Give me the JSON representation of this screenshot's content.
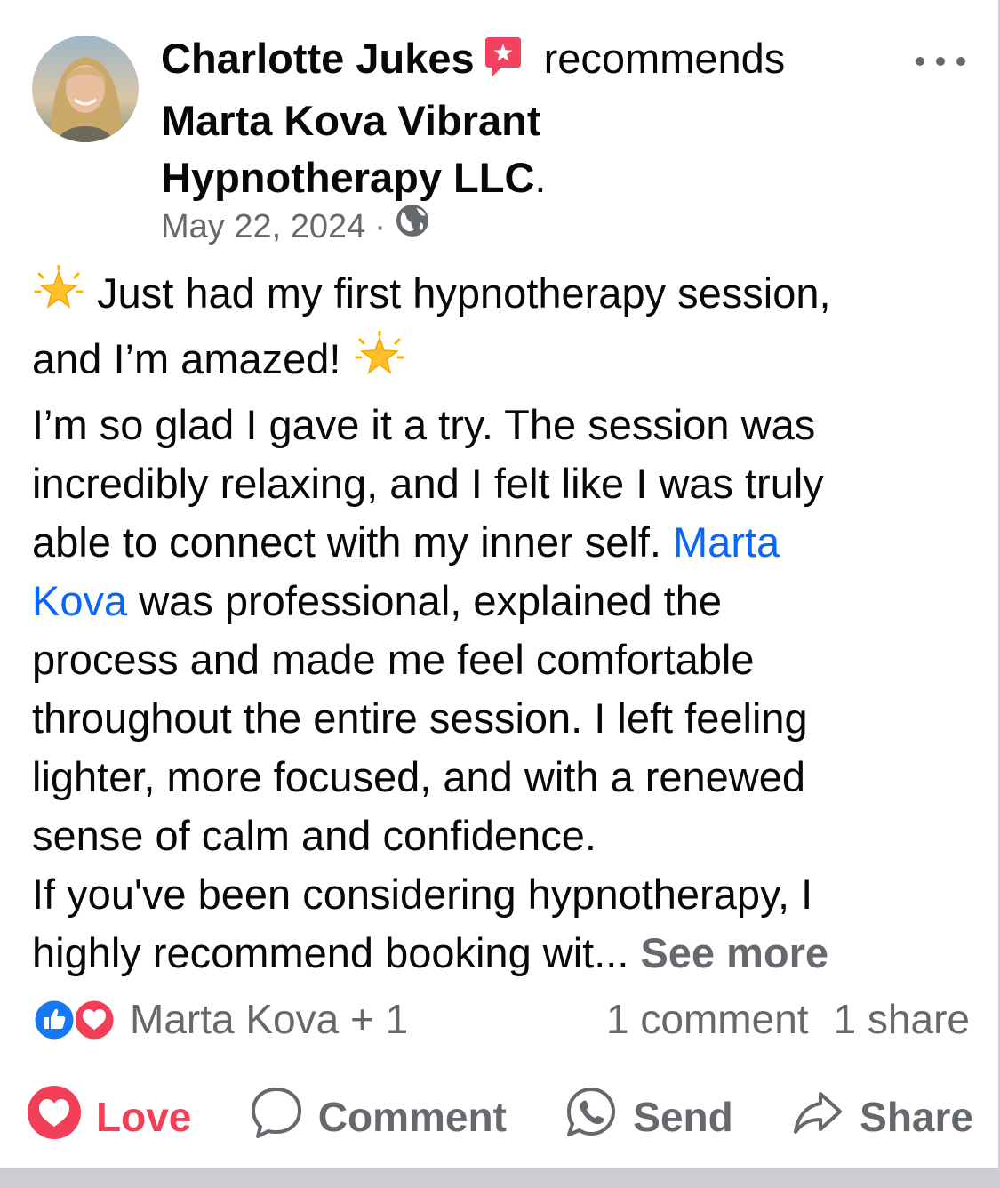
{
  "post": {
    "author": "Charlotte Jukes",
    "action_word": "recommends",
    "page_line1": "Marta Kova Vibrant",
    "page_line2": "Hypnotherapy LLC",
    "page_suffix": ".",
    "date": "May 22, 2024",
    "meta_separator": "·",
    "privacy_icon": "globe-icon",
    "more_icon": "more-horizontal-icon",
    "body": {
      "l1": " Just had my first hypnotherapy session,",
      "l2": "and I’m amazed! ",
      "l3": "I’m so glad I gave it a try. The session was",
      "l4": "incredibly relaxing, and I felt like I was truly",
      "l5": "able to connect with my inner self. ",
      "mention_part1": "Marta",
      "mention_part2": "Kova",
      "l6_rest": " was professional, explained the",
      "l7": "process and made me feel comfortable",
      "l8": "throughout the entire session. I left feeling",
      "l9": "lighter, more focused, and with a renewed",
      "l10": "sense of calm and confidence.",
      "l11": "If you've been considering hypnotherapy, I",
      "l12": "highly recommend booking wit... ",
      "see_more": "See more",
      "emoji": "glowing-star"
    },
    "reactions": {
      "names": "Marta Kova + 1",
      "comments": "1 comment",
      "shares": "1 share",
      "icons": [
        "like-icon",
        "love-icon"
      ]
    },
    "actions": {
      "love": "Love",
      "comment": "Comment",
      "send": "Send",
      "share": "Share"
    },
    "colors": {
      "text": "#080809",
      "secondary": "#65686c",
      "link": "#0866ff",
      "love": "#f33e58",
      "recommend_badge": "#f3425f",
      "like_blue": "#1877f2"
    }
  }
}
